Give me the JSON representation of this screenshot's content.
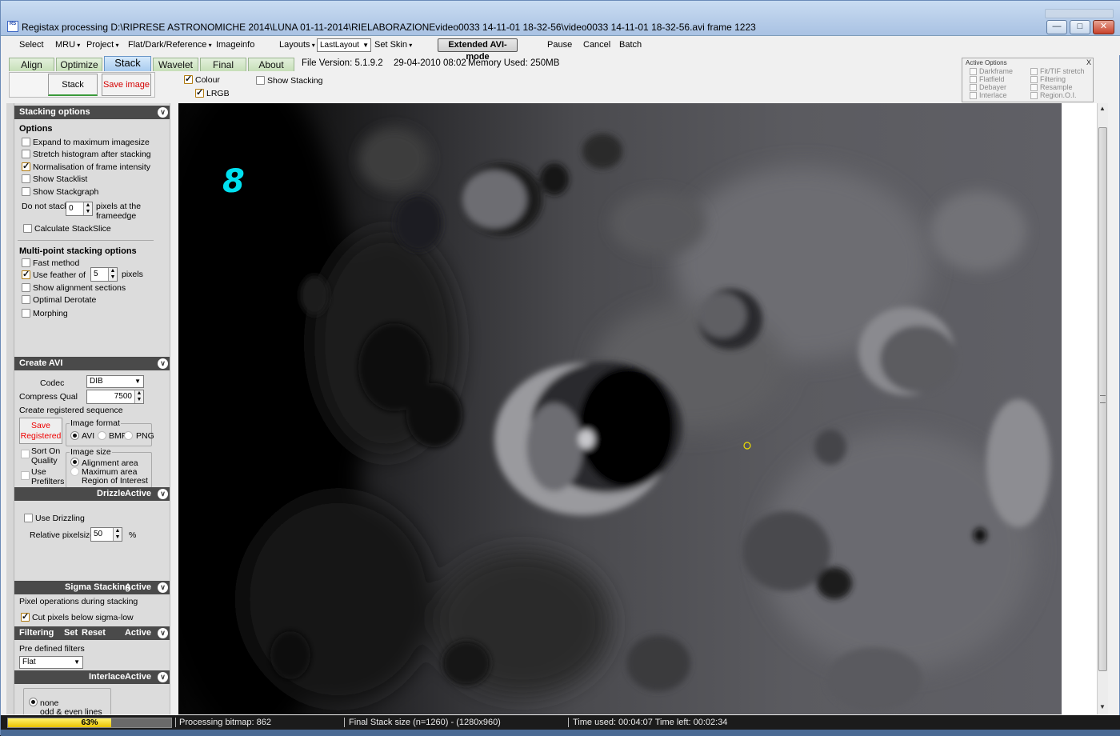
{
  "window": {
    "title": "Registax processing D:\\RIPRESE ASTRONOMICHE 2014\\LUNA 01-11-2014\\RIELABORAZIONEvideo0033 14-11-01 18-32-56\\video0033 14-11-01 18-32-56.avi frame 1223",
    "icon_text": "RS",
    "min_btn": "—",
    "max_btn": "□",
    "close_btn": "✕"
  },
  "menu": {
    "select": "Select",
    "mru": "MRU",
    "project": "Project",
    "flat": "Flat/Dark/Reference",
    "imageinfo": "Imageinfo",
    "layouts": "Layouts",
    "layout_value": "LastLayout",
    "set_skin": "Set Skin",
    "extended_avi": "Extended AVI-mode",
    "pause": "Pause",
    "cancel": "Cancel",
    "batch": "Batch"
  },
  "tabs": [
    {
      "label": "Align"
    },
    {
      "label": "Optimize"
    },
    {
      "label": "Stack",
      "active": true
    },
    {
      "label": "Wavelet"
    },
    {
      "label": "Final"
    },
    {
      "label": "About"
    }
  ],
  "info": {
    "file_version": "File Version: 5.1.9.2",
    "date": "29-04-2010 08:02",
    "memory": "Memory Used: 250MB"
  },
  "toolbar": {
    "stack_label": "Stack",
    "save_image_label": "Save image",
    "colour_label": "Colour",
    "colour_checked": true,
    "lrgb_label": "LRGB",
    "lrgb_checked": true,
    "show_stacking_label": "Show Stacking",
    "show_stacking_checked": false
  },
  "active_options": {
    "header": "Active Options",
    "close": "X",
    "items_left": [
      "Darkframe",
      "Flatfield",
      "Debayer",
      "Interlace"
    ],
    "items_right": [
      "Fit/TIF stretch",
      "Filtering",
      "Resample",
      "Region.O.I."
    ]
  },
  "stacking_options": {
    "title": "Stacking options",
    "options_label": "Options",
    "expand": "Expand to maximum imagesize",
    "stretch": "Stretch histogram after stacking",
    "normalisation": "Normalisation of frame intensity",
    "show_stacklist": "Show Stacklist",
    "show_stackgraph": "Show Stackgraph",
    "do_not_stack": "Do not stack",
    "do_not_stack_value": "0",
    "pixels_at": "pixels at the",
    "frameedge": "frameedge",
    "calc_stackslice": "Calculate StackSlice",
    "multipoint_title": "Multi-point stacking options",
    "fast_method": "Fast method",
    "use_feather": "Use feather of",
    "feather_value": "5",
    "pixels": "pixels",
    "show_alignment": "Show alignment sections",
    "optimal_derotate": "Optimal Derotate",
    "morphing": "Morphing"
  },
  "create_avi": {
    "title": "Create AVI",
    "codec_label": "Codec",
    "codec_value": "DIB",
    "compress_label": "Compress Qual",
    "compress_value": "7500",
    "create_seq": "Create registered sequence",
    "save_registered_1": "Save",
    "save_registered_2": "Registered",
    "image_format": "Image format",
    "avi": "AVI",
    "bmp": "BMP",
    "png": "PNG",
    "sort_on_1": "Sort On",
    "sort_on_2": "Quality",
    "use_prefilters_1": "Use",
    "use_prefilters_2": "Prefilters",
    "image_size": "Image size",
    "alignment_area": "Alignment area",
    "maximum_area": "Maximum area",
    "region_of_interest": "Region of Interest"
  },
  "drizzle": {
    "title": "Drizzle",
    "status": "Active",
    "use_drizzling": "Use Drizzling",
    "relative_pixelsize": "Relative pixelsize",
    "pixelsize_value": "50",
    "percent": "%"
  },
  "sigma": {
    "title": "Sigma Stacking",
    "status": "Active",
    "pixel_ops": "Pixel operations during stacking",
    "cut_pixels": "Cut pixels below sigma-low"
  },
  "filtering": {
    "title": "Filtering",
    "set": "Set",
    "reset": "Reset",
    "status": "Active",
    "predefined": "Pre defined filters",
    "filter_value": "Flat"
  },
  "interlace": {
    "title": "Interlace",
    "status": "Active",
    "none": "none",
    "odd_even": "odd & even lines"
  },
  "image": {
    "frame_number": "8"
  },
  "status": {
    "progress_pct": 63,
    "progress_text": "63%",
    "processing": "Processing bitmap: 862",
    "final_stack": "Final Stack size (n=1260) - (1280x960)",
    "time": "Time used: 00:04:07 Time left: 00:02:34"
  },
  "colors": {
    "accent_green": "#3a9a3a",
    "save_red": "#d40000",
    "frame_cyan": "#00e0f0",
    "progress_yellow": "#f0d000"
  }
}
